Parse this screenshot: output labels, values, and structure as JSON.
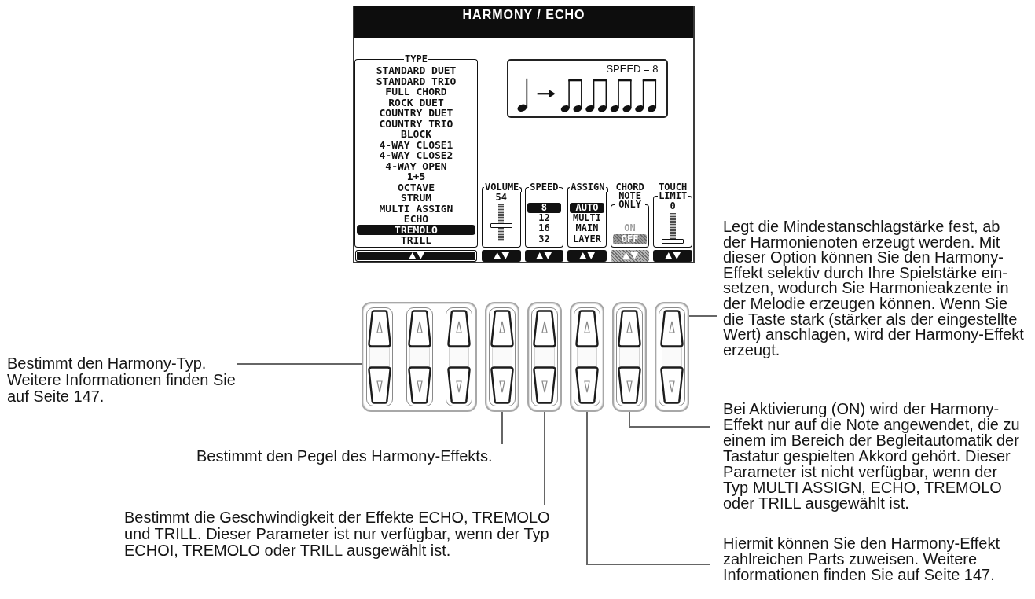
{
  "display": {
    "title": "HARMONY / ECHO",
    "type_list": {
      "label": "TYPE",
      "items": [
        {
          "label": "STANDARD DUET",
          "selected": false
        },
        {
          "label": "STANDARD TRIO",
          "selected": false
        },
        {
          "label": "FULL CHORD",
          "selected": false
        },
        {
          "label": "ROCK DUET",
          "selected": false
        },
        {
          "label": "COUNTRY DUET",
          "selected": false
        },
        {
          "label": "COUNTRY TRIO",
          "selected": false
        },
        {
          "label": "BLOCK",
          "selected": false
        },
        {
          "label": "4-WAY CLOSE1",
          "selected": false
        },
        {
          "label": "4-WAY CLOSE2",
          "selected": false
        },
        {
          "label": "4-WAY OPEN",
          "selected": false
        },
        {
          "label": "1+5",
          "selected": false
        },
        {
          "label": "OCTAVE",
          "selected": false
        },
        {
          "label": "STRUM",
          "selected": false
        },
        {
          "label": "MULTI ASSIGN",
          "selected": false
        },
        {
          "label": "ECHO",
          "selected": false
        },
        {
          "label": "TREMOLO",
          "selected": true
        },
        {
          "label": "TRILL",
          "selected": false
        }
      ]
    },
    "speed_preview": {
      "label": "SPEED = 8"
    },
    "parameters": [
      {
        "kind": "slider",
        "label": "VOLUME",
        "value": "54",
        "level": 0.43,
        "disabled": false
      },
      {
        "kind": "list",
        "label": "SPEED",
        "disabled": false,
        "options": [
          {
            "label": "8",
            "selected": true
          },
          {
            "label": "12",
            "selected": false
          },
          {
            "label": "16",
            "selected": false
          },
          {
            "label": "32",
            "selected": false
          }
        ]
      },
      {
        "kind": "list",
        "label": "ASSIGN",
        "disabled": false,
        "options": [
          {
            "label": "AUTO",
            "selected": true
          },
          {
            "label": "MULTI",
            "selected": false
          },
          {
            "label": "MAIN",
            "selected": false
          },
          {
            "label": "LAYER",
            "selected": false
          }
        ]
      },
      {
        "kind": "list",
        "label": "CHORD NOTE ONLY",
        "disabled": true,
        "options": [
          {
            "label": "ON",
            "selected": false
          },
          {
            "label": "OFF",
            "selected": true
          }
        ]
      },
      {
        "kind": "slider",
        "label": "TOUCH LIMIT",
        "value": "0",
        "level": 0,
        "disabled": false
      }
    ]
  },
  "callouts": {
    "left_column": [
      {
        "text": "Bestimmt den Harmony-Typ.\nWeitere Informationen finden Sie\nauf Seite 147."
      },
      {
        "text": "Bestimmt den Pegel des Harmony-Effekts."
      },
      {
        "text": "Bestimmt die Geschwindigkeit der Effekte ECHO, TREMOLO\nund TRILL. Dieser Parameter ist nur verfügbar, wenn der Typ\nECHOI, TREMOLO oder TRILL ausgewählt ist."
      }
    ],
    "right_column": [
      {
        "text": "Legt die Mindestanschlagstärke fest, ab\nder Harmonienoten erzeugt werden. Mit\ndieser Option können Sie den Harmony-\nEffekt selektiv durch Ihre Spielstärke ein-\nsetzen, wodurch Sie Harmonieakzente in\nder Melodie erzeugen können. Wenn Sie\ndie Taste stark (stärker als der eingestellte\nWert) anschlagen, wird der Harmony-Effekt\nerzeugt."
      },
      {
        "text": "Bei Aktivierung (ON) wird der Harmony-\nEffekt nur auf die Note angewendet, die zu\neinem im Bereich der Begleitautomatik der\nTastatur gespielten Akkord gehört. Dieser\nParameter ist nicht verfügbar, wenn der\nTyp MULTI ASSIGN, ECHO, TREMOLO\noder TRILL ausgewählt ist."
      },
      {
        "text": "Hiermit können Sie den Harmony-Effekt\nzahlreichen Parts zuweisen. Weitere\nInformationen finden Sie auf Seite 147."
      }
    ]
  }
}
